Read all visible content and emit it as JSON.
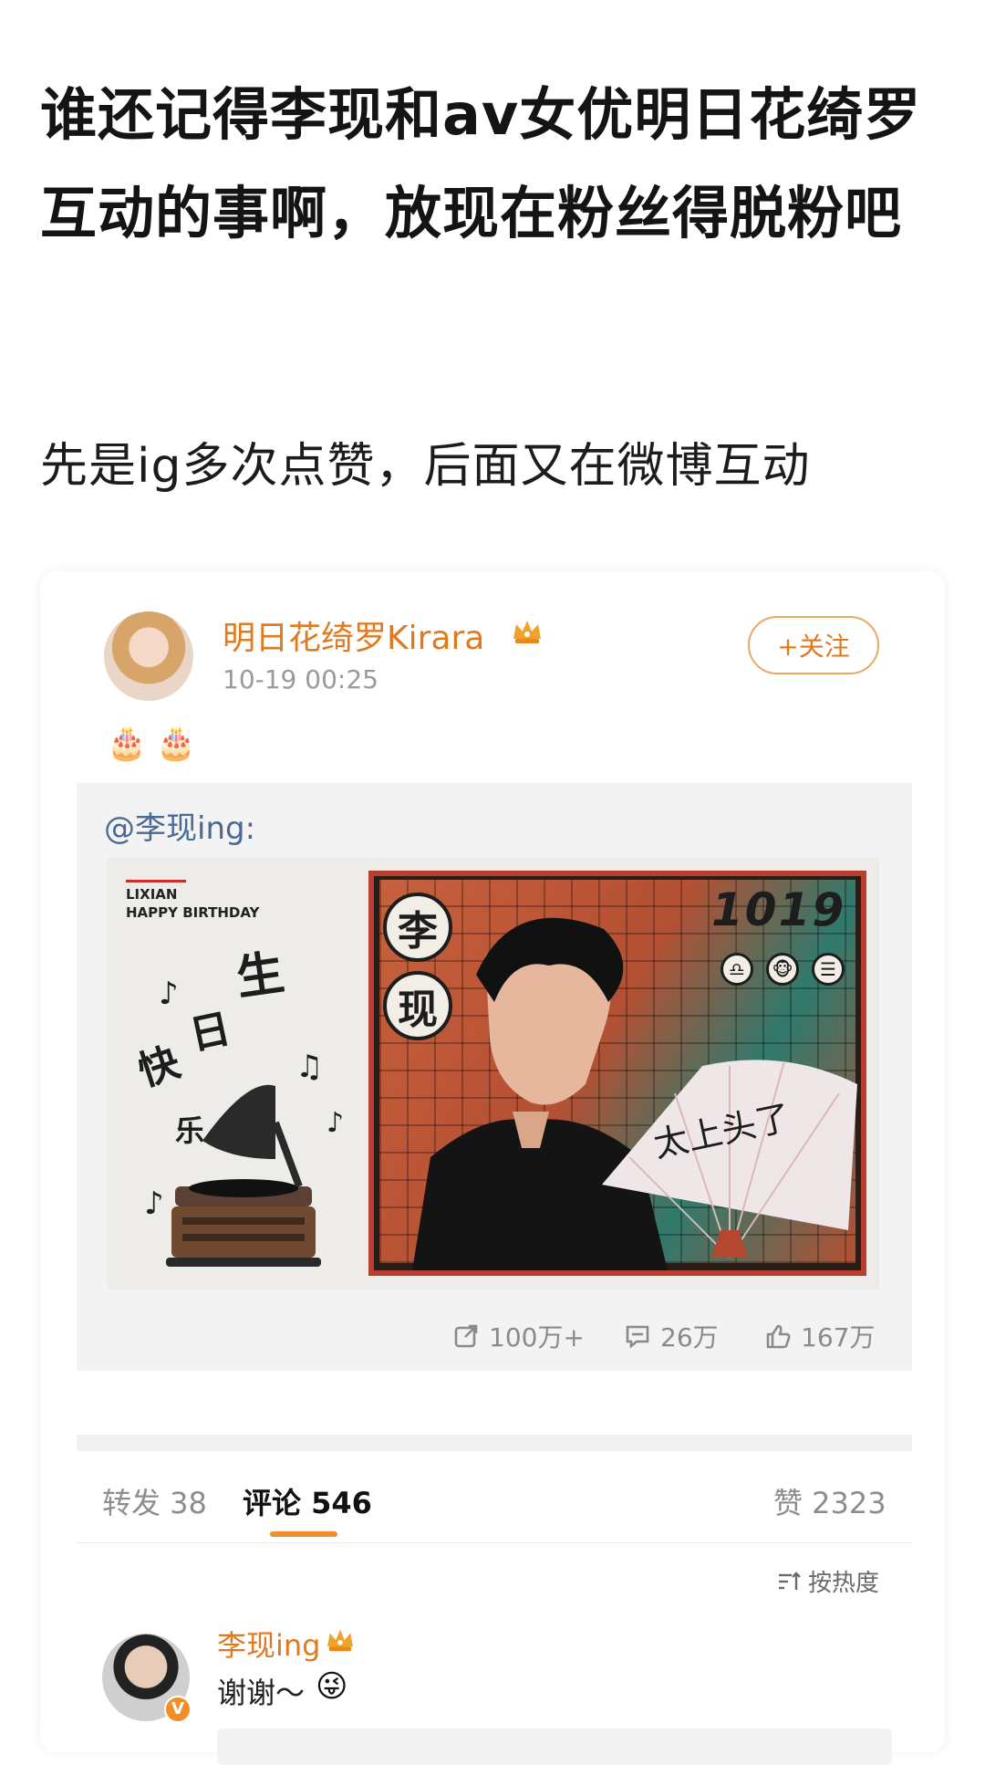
{
  "post": {
    "title": "谁还记得李现和av女优明日花绮罗互动的事啊，放现在粉丝得脱粉吧",
    "subtitle": "先是ig多次点赞，后面又在微博互动"
  },
  "weibo": {
    "poster_name": "明日花绮罗Kirara",
    "timestamp": "10-19 00:25",
    "follow_label": "+关注",
    "emojis": [
      "🎂",
      "🎂"
    ],
    "repost_mention": "@李现ing:",
    "image": {
      "top_text_line1": "LIXIAN",
      "top_text_line2": "HAPPY BIRTHDAY",
      "left_calligraphy": "生日快乐",
      "name_char1": "李",
      "name_char2": "现",
      "date": "1019",
      "fan_text": "太上头了",
      "zodiac_icons": [
        "♎",
        "🐵",
        "☰"
      ]
    },
    "stats": {
      "forward": "100万+",
      "comment": "26万",
      "like": "167万"
    },
    "tabs": {
      "forward": "转发 38",
      "comment": "评论 546",
      "like": "赞 2323"
    },
    "sort_label": "按热度",
    "comment": {
      "user": "李现ing",
      "text": "谢谢～",
      "emoji": "😜"
    }
  },
  "colors": {
    "accent": "#e07a20",
    "underline": "#f08e2a",
    "mention": "#4a6a94"
  },
  "icons": {
    "forward": "share-icon",
    "comment": "comment-icon",
    "like": "thumbs-up-icon",
    "sort": "sort-icon",
    "vip": "vip-crown-icon",
    "verified": "verified-v-icon"
  }
}
